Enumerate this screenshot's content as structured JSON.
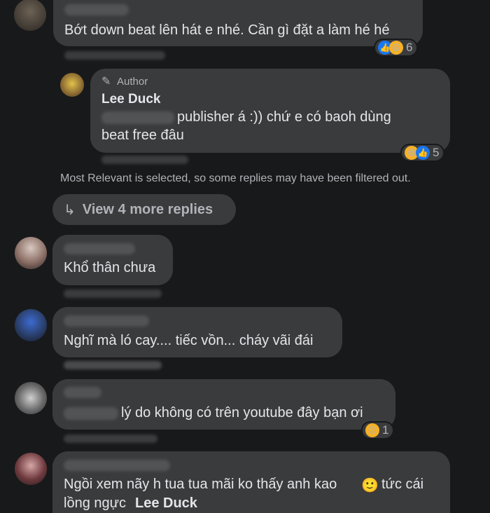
{
  "comments": [
    {
      "text": "Bớt down beat lên hát e nhé. Cần gì đặt a làm hé hé",
      "reaction_count": "6"
    },
    {
      "author_badge": "Author",
      "author_name": "Lee Duck",
      "text_line1": "publisher á :)) chứ e có baoh dùng",
      "text_line2": "beat free đâu",
      "reaction_count": "5"
    },
    {
      "text": "Khổ thân chưa"
    },
    {
      "text": "Nghĩ mà ló cay.... tiếc vồn... cháy vãi đái"
    },
    {
      "text": "lý do không có trên youtube đây bạn ơi",
      "reaction_count": "1"
    },
    {
      "text_line1": "Ngồi xem nãy h tua tua mãi ko thấy anh kao",
      "text_line1_after": "tức cái",
      "text_line2": "lồng ngực",
      "mention": "Lee Duck"
    }
  ],
  "filter_notice": "Most Relevant is selected, so some replies may have been filtered out.",
  "view_more": "View 4 more replies",
  "icons": {
    "like": "like-icon",
    "haha": "haha-icon",
    "sad": "sad-icon",
    "smile": "smile-emoji-icon",
    "pencil": "pencil-icon",
    "reply_arrow": "reply-arrow-icon"
  }
}
